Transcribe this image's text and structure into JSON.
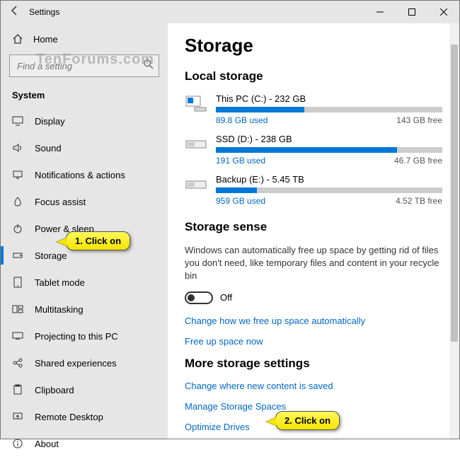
{
  "window": {
    "title": "Settings"
  },
  "watermark": "TenForums.com",
  "sidebar": {
    "home": "Home",
    "search_placeholder": "Find a setting",
    "section": "System",
    "items": [
      {
        "label": "Display"
      },
      {
        "label": "Sound"
      },
      {
        "label": "Notifications & actions"
      },
      {
        "label": "Focus assist"
      },
      {
        "label": "Power & sleep"
      },
      {
        "label": "Storage"
      },
      {
        "label": "Tablet mode"
      },
      {
        "label": "Multitasking"
      },
      {
        "label": "Projecting to this PC"
      },
      {
        "label": "Shared experiences"
      },
      {
        "label": "Clipboard"
      },
      {
        "label": "Remote Desktop"
      },
      {
        "label": "About"
      }
    ]
  },
  "page": {
    "title": "Storage",
    "local_heading": "Local storage",
    "drives": [
      {
        "name": "This PC (C:) - 232 GB",
        "used": "89.8 GB used",
        "free": "143 GB free",
        "pct": 39
      },
      {
        "name": "SSD (D:) - 238 GB",
        "used": "191 GB used",
        "free": "46.7 GB free",
        "pct": 80
      },
      {
        "name": "Backup (E:) - 5.45 TB",
        "used": "959 GB used",
        "free": "4.52 TB free",
        "pct": 18
      }
    ],
    "sense_heading": "Storage sense",
    "sense_desc": "Windows can automatically free up space by getting rid of files you don't need, like temporary files and content in your recycle bin",
    "toggle_label": "Off",
    "link_change_free": "Change how we free up space automatically",
    "link_free_now": "Free up space now",
    "more_heading": "More storage settings",
    "link_new_content": "Change where new content is saved",
    "link_manage_spaces": "Manage Storage Spaces",
    "link_optimize": "Optimize Drives"
  },
  "callouts": {
    "c1": "1. Click on",
    "c2": "2. Click on"
  }
}
